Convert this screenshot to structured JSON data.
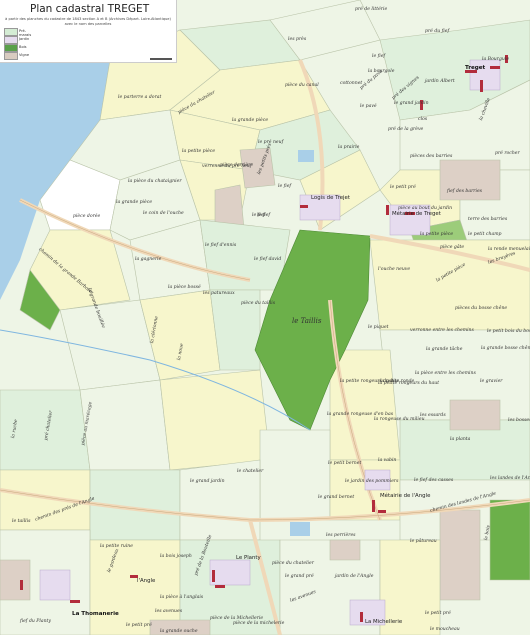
{
  "map": {
    "title": "Plan cadastral TREGET",
    "subtitle_1": "à partir des planches du cadastre de 1843 section A et B (Archives Départ. Loire-Atlantique)",
    "subtitle_2": "avec le nom des parcelles",
    "legend": [
      {
        "label": "Pré-marais",
        "color": "#d4ecd4"
      },
      {
        "label": "Jardin",
        "color": "#e6dcef"
      },
      {
        "label": "Bois",
        "color": "#5aa04a"
      },
      {
        "label": "Vigne",
        "color": "#d8cbc0"
      }
    ],
    "colors": {
      "water": "#a9cfe8",
      "meadow": "#dff0dc",
      "pale": "#eef5e6",
      "yellow": "#f7f6cc",
      "wood": "#6cb04a",
      "vine": "#ddd0c6",
      "garden": "#e6dcef",
      "building": "#b22c3c",
      "road": "#f0d8b8"
    },
    "places": [
      "Treget",
      "Logis de Trejet",
      "Métairie de Treget",
      "Métairie de l'Angle",
      "Le Planty",
      "l'Angle",
      "La Thomanerie",
      "La Michellerie"
    ],
    "parcels": [
      "pré de littérie",
      "les près",
      "pré du fief",
      "le fief",
      "la bourgole",
      "cottonnet",
      "jardin Albert",
      "pré des vignes",
      "la Bourgule",
      "le grand jardin",
      "pré du pavé",
      "le pavé",
      "pré de la grève",
      "clos",
      "la cheville",
      "le parterre a dorat",
      "pièce du chatelier",
      "pièce du canal",
      "la grande pièce",
      "la petite pièce",
      "le pré neuf",
      "la prairie",
      "verrenne du pré neuf",
      "la pièce du chataignier",
      "la grande pièce",
      "le fief",
      "le fief",
      "les petits prés",
      "pièces des barries",
      "pré rocher",
      "le petit pré",
      "pièce derrière",
      "pièce dorée",
      "le coin de l'ouche",
      "fief des barries",
      "pièce au bout du jardin",
      "terre des barries",
      "le petit champ",
      "la petite pièce",
      "pièce gâte",
      "la rende menuelaire",
      "le fief d'ennis",
      "le fief david",
      "le fief",
      "chemin de la grande Barbotte",
      "la gagnerie",
      "l'ouche neuve",
      "la petite pièce",
      "la pièce bossé",
      "les patureaux",
      "les bruyères",
      "le petit bois du bosse",
      "pièce du taillis",
      "le Taillis",
      "la grande bouillée",
      "le piquet",
      "verronne entre les chemins",
      "la grande tâche",
      "pièces du bosse chêne",
      "la grande bosse chêne",
      "la pièce entre les chemins",
      "le gravier",
      "la clérionne",
      "la noue",
      "la petite ronde",
      "la petite rongeurs du bas",
      "la petite rongeurs du haut",
      "la grande rongeuse d'en bas",
      "la rongeuse du milieu",
      "les essards",
      "les bosses",
      "la planta",
      "le petit bernet",
      "la vabin",
      "le jardin des pommiers",
      "le fief des casses",
      "les landes de l'Angle",
      "le grand bernet",
      "le chatelier",
      "chemin des prés de l'Angle",
      "chemin des landes de l'Angle",
      "la ruche",
      "pré chatelier",
      "pièce au marécage",
      "le grand jardin",
      "les perrières",
      "le pâtureau",
      "le taillis",
      "le bois",
      "pièce du chatelier",
      "la petite ruine",
      "pré de la Bouteille",
      "le grand pré",
      "jardin de l'Angle",
      "le gardeau",
      "la bois joseph",
      "les avenues",
      "la pièce à l'anglais",
      "les avenues",
      "pièce de la Michellerie",
      "le petit pré",
      "pièce de la michelerie",
      "fief du Planty",
      "la grande ouche",
      "le petit pré",
      "le moucheau"
    ]
  }
}
